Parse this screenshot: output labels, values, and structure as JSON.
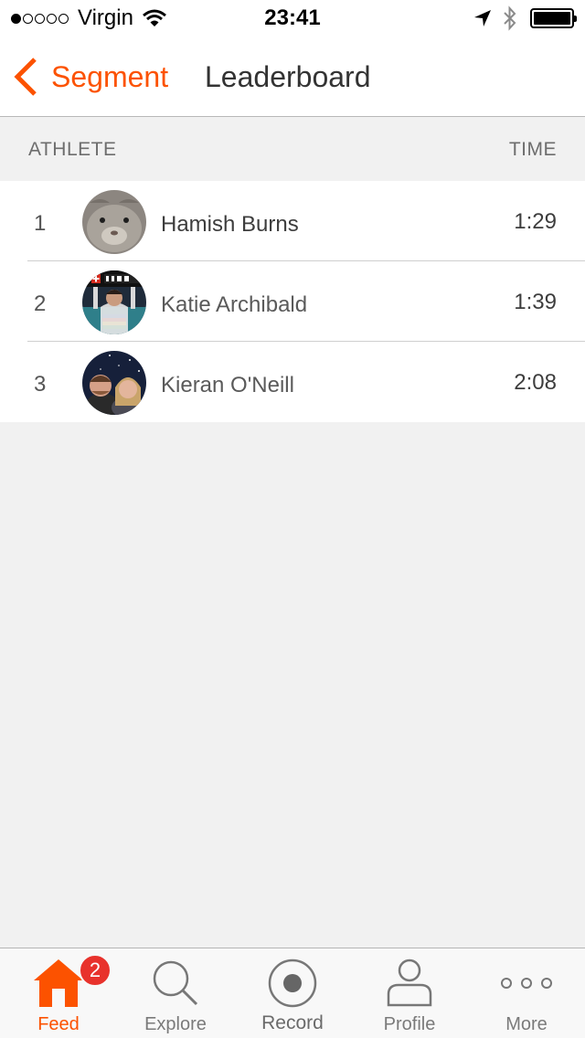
{
  "status_bar": {
    "carrier": "Virgin",
    "signal_bars_filled": 1,
    "signal_bars_total": 5,
    "time": "23:41",
    "battery_level": 1.0,
    "icons": [
      "wifi-icon",
      "location-arrow-icon",
      "bluetooth-icon",
      "battery-icon"
    ]
  },
  "nav": {
    "back_label": "Segment",
    "back_icon": "chevron-left-icon",
    "title": "Leaderboard"
  },
  "table": {
    "headers": {
      "athlete": "ATHLETE",
      "time": "TIME"
    },
    "rows": [
      {
        "rank": "1",
        "name": "Hamish Burns",
        "time": "1:29",
        "avatar": "avatar-photo"
      },
      {
        "rank": "2",
        "name": "Katie Archibald",
        "time": "1:39",
        "avatar": "avatar-photo"
      },
      {
        "rank": "3",
        "name": "Kieran O'Neill",
        "time": "2:08",
        "avatar": "avatar-photo"
      }
    ]
  },
  "tab_bar": {
    "tabs": [
      {
        "label": "Feed",
        "icon": "home-icon",
        "active": true,
        "badge": "2"
      },
      {
        "label": "Explore",
        "icon": "search-icon",
        "active": false
      },
      {
        "label": "Record",
        "icon": "record-icon",
        "active": false
      },
      {
        "label": "Profile",
        "icon": "profile-icon",
        "active": false
      },
      {
        "label": "More",
        "icon": "more-icon",
        "active": false
      }
    ]
  },
  "colors": {
    "accent": "#fc5200",
    "badge": "#e8322c",
    "background": "#f1f1f1",
    "text": "#3d3d3d",
    "header_text": "#6d6d6d"
  }
}
